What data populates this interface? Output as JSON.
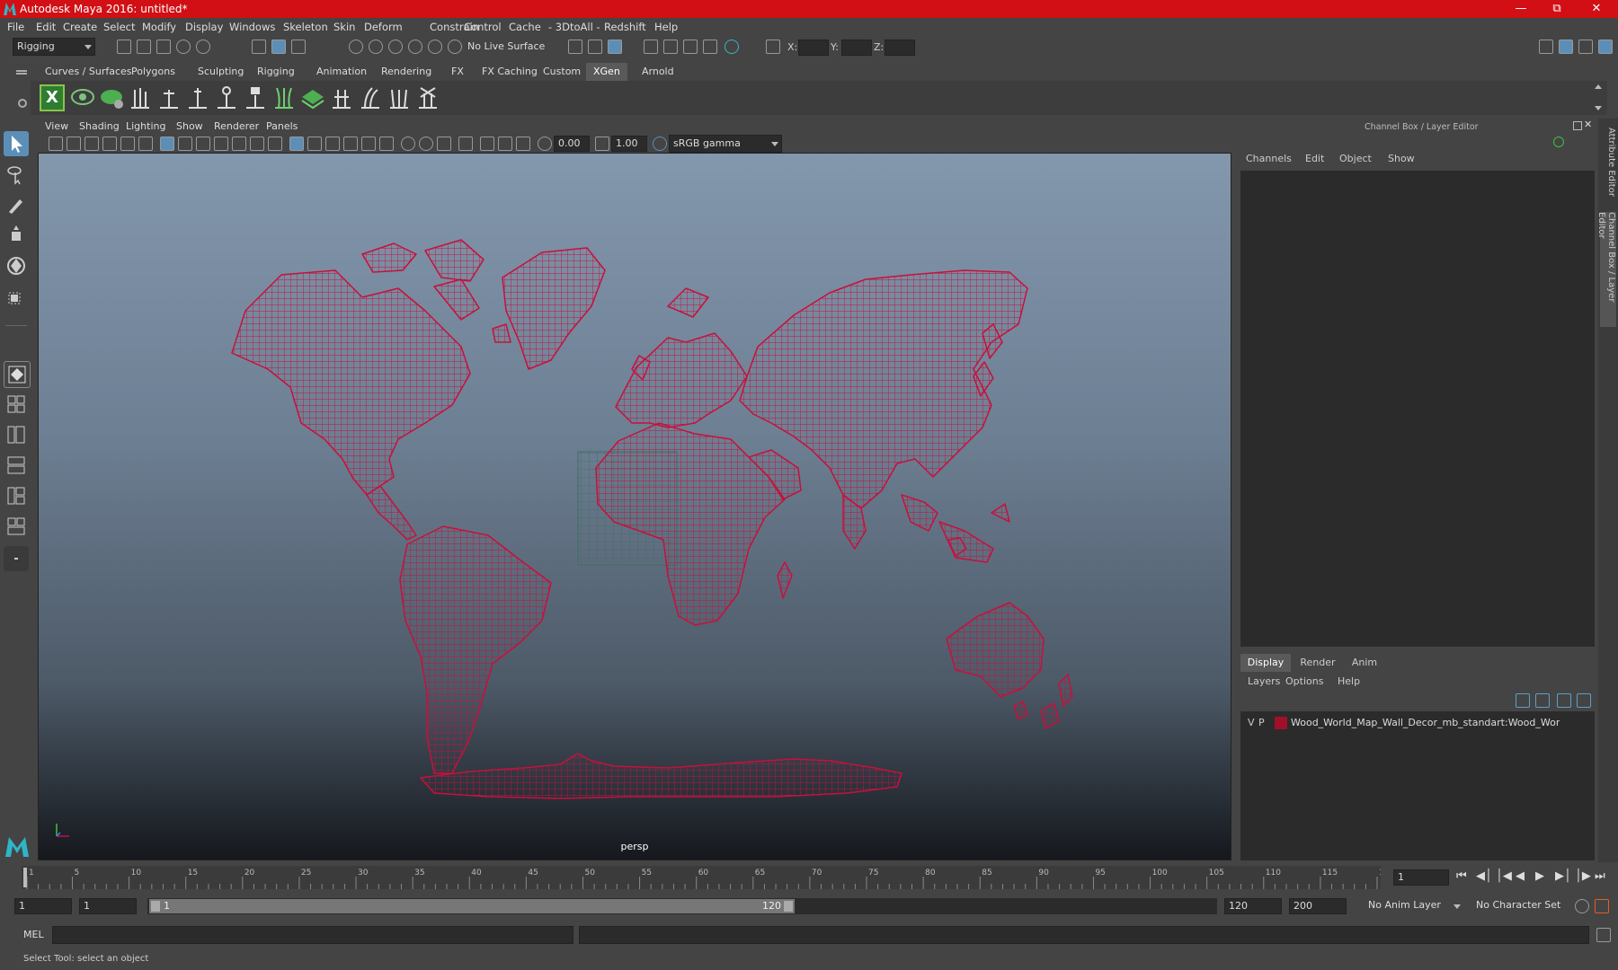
{
  "window": {
    "title": "Autodesk Maya 2016: untitled*"
  },
  "menubar": [
    "File",
    "Edit",
    "Create",
    "Select",
    "Modify",
    "Display",
    "Windows",
    "Skeleton",
    "Skin",
    "Deform",
    "Constrain",
    "Control",
    "Cache",
    "- 3DtoAll -",
    "Redshift",
    "Help"
  ],
  "statusline": {
    "menuset": "Rigging",
    "live_surface": "No Live Surface",
    "x_label": "X:",
    "y_label": "Y:",
    "z_label": "Z:"
  },
  "shelf": {
    "tabs": [
      "Curves / Surfaces",
      "Polygons",
      "Sculpting",
      "Rigging",
      "Animation",
      "Rendering",
      "FX",
      "FX Caching",
      "Custom",
      "XGen",
      "Arnold"
    ],
    "active_tab": "XGen"
  },
  "viewport": {
    "menus": [
      "View",
      "Shading",
      "Lighting",
      "Show",
      "Renderer",
      "Panels"
    ],
    "exposure": "0.00",
    "gamma": "1.00",
    "colorspace": "sRGB gamma",
    "camera": "persp",
    "mesh_color": "#c8103c"
  },
  "channel_box": {
    "title": "Channel Box / Layer Editor",
    "menus": [
      "Channels",
      "Edit",
      "Object",
      "Show"
    ]
  },
  "layer_editor": {
    "tabs": [
      "Display",
      "Render",
      "Anim"
    ],
    "active_tab": "Display",
    "menus": [
      "Layers",
      "Options",
      "Help"
    ],
    "layer": {
      "v": "V",
      "p": "P",
      "name": "Wood_World_Map_Wall_Decor_mb_standart:Wood_Wor",
      "color": "#a0102a"
    }
  },
  "side_tabs": [
    "Attribute Editor",
    "Channel Box / Layer Editor"
  ],
  "time_slider": {
    "ticks": [
      "1",
      "5",
      "10",
      "15",
      "20",
      "25",
      "30",
      "35",
      "40",
      "45",
      "50",
      "55",
      "60",
      "65",
      "70",
      "75",
      "80",
      "85",
      "90",
      "95",
      "100",
      "105",
      "110",
      "115",
      "120"
    ],
    "current_frame": "1"
  },
  "range": {
    "start": "1",
    "playback_start": "1",
    "slider_start": "1",
    "slider_end": "120",
    "playback_end": "120",
    "end": "200",
    "anim_layer": "No Anim Layer",
    "character_set": "No Character Set"
  },
  "command_line": {
    "label": "MEL"
  },
  "help_line": "Select Tool: select an object"
}
